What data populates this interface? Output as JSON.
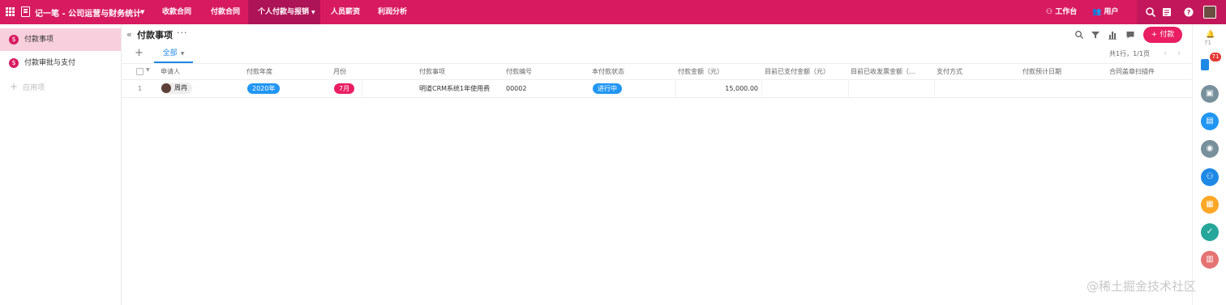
{
  "topbar": {
    "app_title": "记一笔 - 公司运营与财务统计",
    "nav": [
      {
        "label": "收款合同"
      },
      {
        "label": "付款合同"
      },
      {
        "label": "个人付款与报销"
      },
      {
        "label": "人员薪资"
      },
      {
        "label": "利润分析"
      }
    ],
    "workbench": "工作台",
    "users": "用户",
    "colors": {
      "bar": "#d81b60",
      "active_tab": "#ad1457"
    }
  },
  "sidebar": {
    "items": [
      {
        "label": "付款事项",
        "icon": "dollar-icon"
      },
      {
        "label": "付款审批与支付",
        "icon": "dollar-icon"
      }
    ],
    "add_app": "应用项"
  },
  "main": {
    "title": "付款事项",
    "more": "···",
    "pay_button": "+ 付款",
    "tab_all": "全部",
    "pager_text": "共1行，1/1页",
    "columns": [
      "申请人",
      "付款年度",
      "月份",
      "付款事项",
      "付款编号",
      "本付款状态",
      "付款金额（元）",
      "目前已支付金额（元）",
      "目前已收发票金额（…",
      "支付方式",
      "付款预计日期",
      "合同盖章扫描件"
    ],
    "rows": [
      {
        "index": "1",
        "applicant": "周冉",
        "year": "2020年",
        "month": "7月",
        "item": "明道CRM系统1年使用费",
        "code": "00002",
        "status": "进行中",
        "amount": "15,000.00"
      }
    ],
    "pill_colors": {
      "year": "#2196f3",
      "month": "#e91e63",
      "status": "#2196f3"
    }
  },
  "rail": {
    "notif_count": "71",
    "badge": "71",
    "buttons": [
      {
        "icon": "briefcase-icon",
        "color": "#78909c"
      },
      {
        "icon": "chat-icon",
        "color": "#2196f3"
      },
      {
        "icon": "bell-icon",
        "color": "#78909c"
      },
      {
        "icon": "org-icon",
        "color": "#1e88e5"
      },
      {
        "icon": "apps-icon",
        "color": "#ffa726"
      },
      {
        "icon": "check-icon",
        "color": "#26a69a"
      },
      {
        "icon": "calendar-icon",
        "color": "#e57373"
      }
    ]
  },
  "watermark": "@稀土掘金技术社区"
}
